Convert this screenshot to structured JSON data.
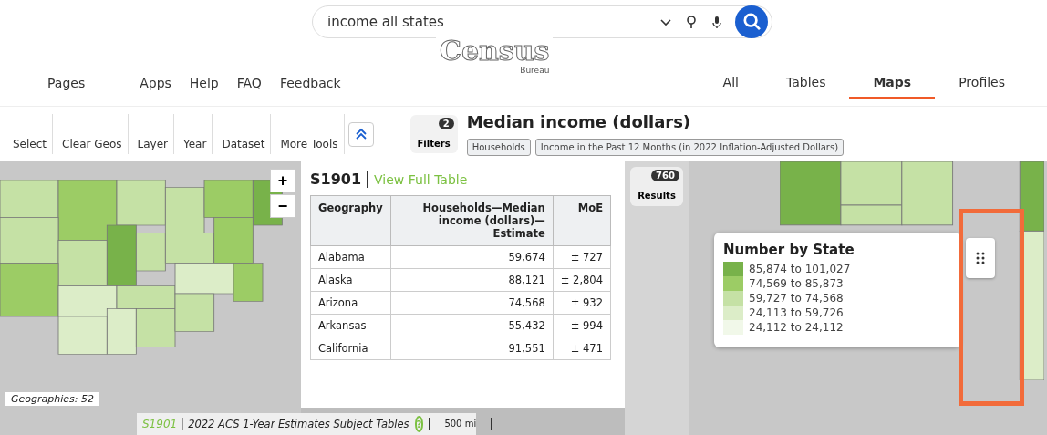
{
  "search": {
    "value": "income all states"
  },
  "logo": {
    "name": "Census",
    "sub": "Bureau"
  },
  "nav_left": [
    "Pages",
    "Apps",
    "Help",
    "FAQ",
    "Feedback"
  ],
  "nav_tabs": [
    {
      "label": "All",
      "selected": false
    },
    {
      "label": "Tables",
      "selected": false
    },
    {
      "label": "Maps",
      "selected": true
    },
    {
      "label": "Profiles",
      "selected": false
    }
  ],
  "tools": [
    "Select",
    "Clear Geos",
    "Layer",
    "Year",
    "Dataset",
    "More Tools"
  ],
  "filters": {
    "label": "Filters",
    "count": "2"
  },
  "results": {
    "label": "Results",
    "count": "760"
  },
  "title": "Median income (dollars)",
  "chips": [
    "Households",
    "Income in the Past 12 Months (in 2022 Inflation-Adjusted Dollars)"
  ],
  "map": {
    "geographies": "Geographies: 52",
    "zoom_in": "+",
    "zoom_out": "−",
    "scale": "500 mi"
  },
  "table_panel": {
    "code": "S1901",
    "link": "View Full Table",
    "columns": [
      "Geography",
      "Households—Median income (dollars)—Estimate",
      "MoE"
    ],
    "rows": [
      [
        "Alabama",
        "59,674",
        "± 727"
      ],
      [
        "Alaska",
        "88,121",
        "± 2,804"
      ],
      [
        "Arizona",
        "74,568",
        "± 932"
      ],
      [
        "Arkansas",
        "55,432",
        "± 994"
      ],
      [
        "California",
        "91,551",
        "± 471"
      ]
    ]
  },
  "footer": {
    "code": "S1901",
    "text": "2022 ACS 1-Year Estimates Subject Tables",
    "help": "?"
  },
  "legend": {
    "title": "Number by State",
    "items": [
      {
        "label": "85,874 to 101,027",
        "color": "#78b24a"
      },
      {
        "label": "74,569 to 85,873",
        "color": "#9ccc65"
      },
      {
        "label": "59,727 to 74,568",
        "color": "#c5e1a5"
      },
      {
        "label": "24,113 to 59,726",
        "color": "#dcedc8"
      },
      {
        "label": "24,112 to 24,112",
        "color": "#f1f8e9"
      }
    ]
  }
}
